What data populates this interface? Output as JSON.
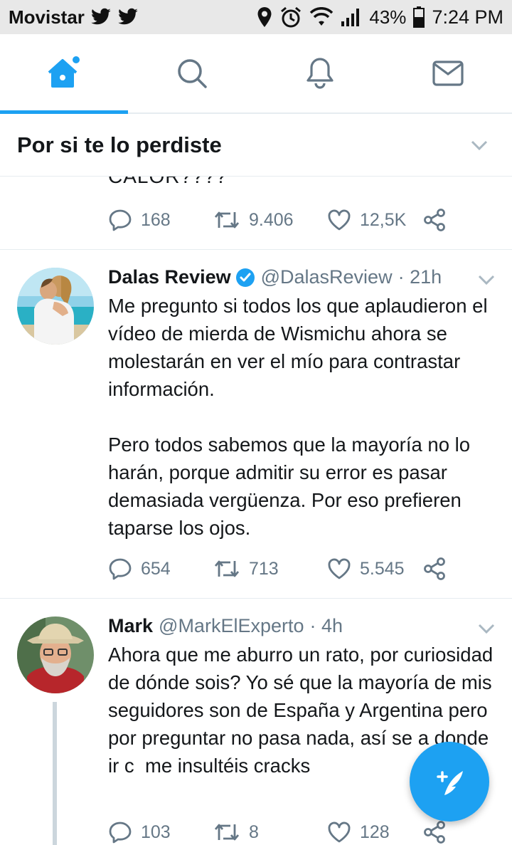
{
  "status_bar": {
    "carrier": "Movistar",
    "battery_percent": "43%",
    "time": "7:24 PM",
    "icons": [
      "twitter-notification-icon",
      "twitter-notification-icon",
      "location-icon",
      "alarm-icon",
      "wifi-icon",
      "signal-icon",
      "battery-icon"
    ]
  },
  "nav": {
    "tabs": [
      {
        "name": "home",
        "icon": "home-icon",
        "active": true
      },
      {
        "name": "search",
        "icon": "search-icon",
        "active": false
      },
      {
        "name": "notifications",
        "icon": "bell-icon",
        "active": false
      },
      {
        "name": "messages",
        "icon": "envelope-icon",
        "active": false
      }
    ],
    "accent": "#1da1f2"
  },
  "section": {
    "title": "Por si te lo perdiste"
  },
  "partial_tweet": {
    "text_fragment": "CALOR????",
    "replies": "168",
    "retweets": "9.406",
    "likes": "12,5K"
  },
  "tweets": [
    {
      "name": "Dalas Review",
      "verified": true,
      "handle": "@DalasReview",
      "time": "· 21h",
      "body": "Me pregunto si todos los que aplaudieron el vídeo de mierda de Wismichu ahora se molestarán en ver el mío para contrastar información.\n\nPero todos sabemos que la mayoría no lo harán, porque admitir su error es pasar demasiada vergüenza. Por eso prefieren taparse los ojos.",
      "replies": "654",
      "retweets": "713",
      "likes": "5.545"
    },
    {
      "name": "Mark",
      "verified": false,
      "handle": "@MarkElExperto",
      "time": "· 4h",
      "body": "Ahora que me aburro un rato, por curiosidad de dónde sois? Yo sé que la mayoría de mis seguidores son de España y Argentina pero por preguntar no pasa nada, así se a donde ir c  me insultéis cracks",
      "replies": "103",
      "retweets": "8",
      "likes": "128"
    }
  ],
  "colors": {
    "text": "#14171a",
    "secondary": "#657786",
    "divider": "#e6ecf0",
    "verified": "#1da1f2"
  }
}
